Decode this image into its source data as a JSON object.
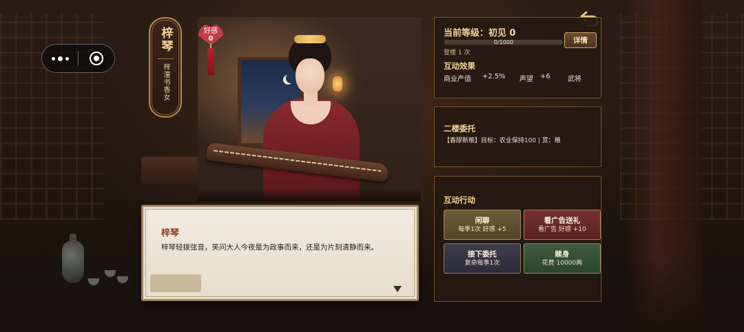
{
  "character": {
    "name": "梓琴",
    "title": "梓潼书香女",
    "favor_label": "好感",
    "favor_value": "0"
  },
  "dialog": {
    "speaker": "梓琴",
    "text": "梓琴轻拨弦音，笑问大人今夜是为政事而来，还是为片刻清静而来。"
  },
  "status": {
    "level_text": "当前等级：初见 0",
    "exp_text": "0/1000",
    "exp_current": 0,
    "exp_max": 1000,
    "visit_text": "登楼 1 次",
    "details_label": "详情"
  },
  "effects": {
    "title": "互动效果",
    "items": [
      "商业产值",
      "+2.5%",
      "声望",
      "+6",
      "武将"
    ]
  },
  "entrust": {
    "title": "二楼委托",
    "text": "【春醪新粮】目标：农业保持100 | 赏：粮"
  },
  "actions": {
    "title": "互动行动",
    "chat": {
      "label": "闲聊",
      "sub": "每季1次  好感 +5"
    },
    "gift": {
      "label": "看广告送礼",
      "sub": "看广告  好感 +10"
    },
    "task": {
      "label": "接下委托",
      "sub": "复命每季1次"
    },
    "redeem": {
      "label": "赎身",
      "sub": "花费 10000两"
    }
  },
  "icons": {
    "menu": "more-dots-icon",
    "close": "target-circle-icon",
    "back": "return-arrow-icon"
  },
  "colors": {
    "gold": "#f2d49a",
    "panel_border": "#7b5a35",
    "dialog_name": "#8b3b22"
  }
}
